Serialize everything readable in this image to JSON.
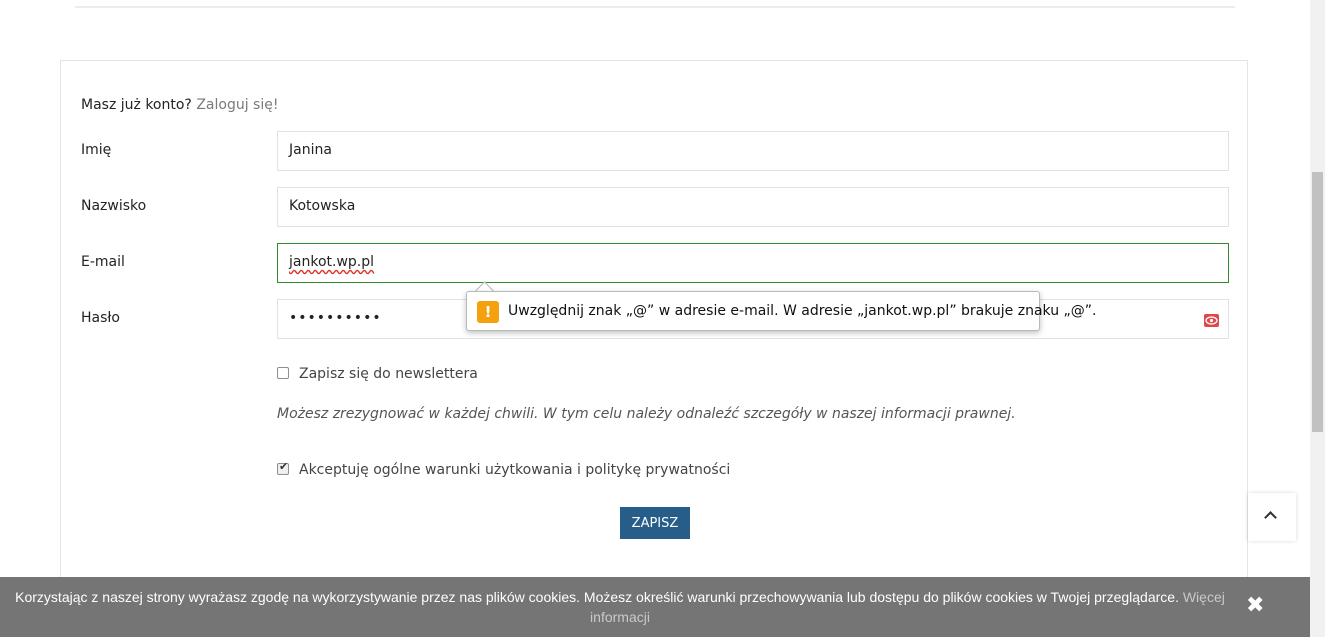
{
  "login": {
    "prompt": "Masz już konto?",
    "link": "Zaloguj się!"
  },
  "form": {
    "first_name": {
      "label": "Imię",
      "value": "Janina"
    },
    "last_name": {
      "label": "Nazwisko",
      "value": "Kotowska"
    },
    "email": {
      "label": "E-mail",
      "value": "jankot.wp.pl"
    },
    "password": {
      "label": "Hasło",
      "value": "••••••••••"
    },
    "newsletter": {
      "label": "Zapisz się do newslettera",
      "checked": false
    },
    "newsletter_note": "Możesz zrezygnować w każdej chwili. W tym celu należy odnaleźć szczegóły w naszej informacji prawnej.",
    "terms": {
      "label": "Akceptuję ogólne warunki użytkowania i politykę prywatności",
      "checked": true
    },
    "submit_label": "ZAPISZ"
  },
  "validation_tooltip": {
    "icon": "warning-icon",
    "message": "Uwzględnij znak „@” w adresie e-mail. W adresie „jankot.wp.pl” brakuje znaku „@”."
  },
  "cookie_bar": {
    "text": "Korzystając z naszej strony wyrażasz zgodę na wykorzystywanie przez nas plików cookies. Możesz określić warunki przechowywania lub dostępu do plików cookies w Twojej przeglądarce.",
    "link": "Więcej informacji",
    "close": "✖"
  },
  "colors": {
    "primary_button": "#275d89",
    "focus_border": "#2e8b2e",
    "warning": "#f5a00f",
    "eye_icon": "#e0474c"
  }
}
